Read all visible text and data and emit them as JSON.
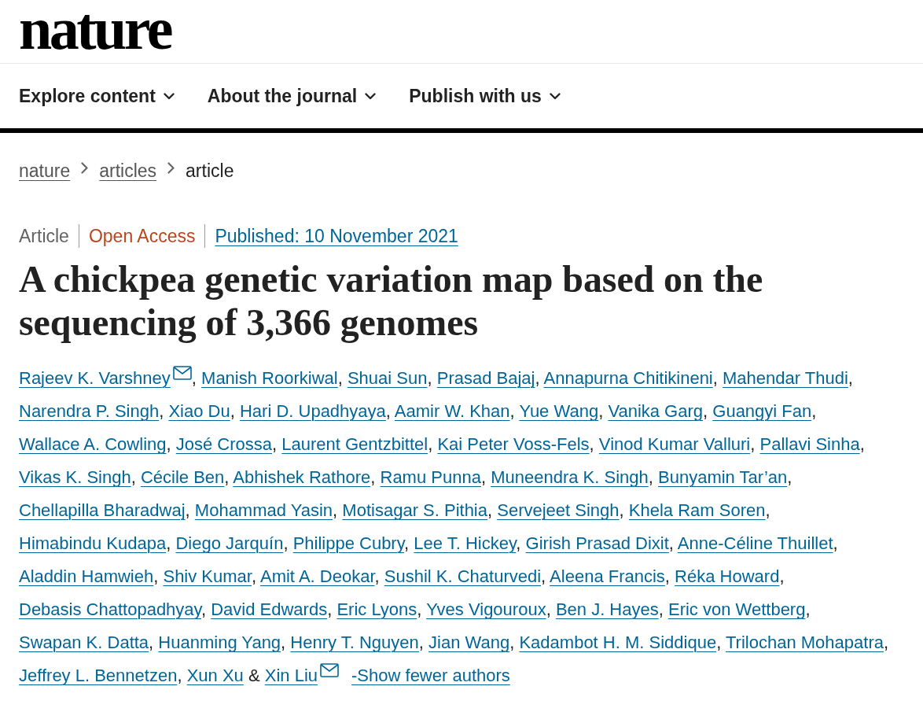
{
  "logo": "nature",
  "nav": [
    {
      "label": "Explore content"
    },
    {
      "label": "About the journal"
    },
    {
      "label": "Publish with us"
    }
  ],
  "breadcrumb": [
    {
      "label": "nature",
      "current": false
    },
    {
      "label": "articles",
      "current": false
    },
    {
      "label": "article",
      "current": true
    }
  ],
  "meta": {
    "article_type": "Article",
    "access": "Open Access",
    "published": "Published: 10 November 2021"
  },
  "title": "A chickpea genetic variation map based on the sequencing of 3,366 genomes",
  "authors": [
    {
      "name": "Rajeev K. Varshney",
      "email": true,
      "separator": ","
    },
    {
      "name": "Manish Roorkiwal",
      "email": false,
      "separator": ","
    },
    {
      "name": "Shuai Sun",
      "email": false,
      "separator": ","
    },
    {
      "name": "Prasad Bajaj",
      "email": false,
      "separator": ","
    },
    {
      "name": "Annapurna Chitikineni",
      "email": false,
      "separator": ","
    },
    {
      "name": "Mahendar Thudi",
      "email": false,
      "separator": ","
    },
    {
      "name": "Narendra P. Singh",
      "email": false,
      "separator": ","
    },
    {
      "name": "Xiao Du",
      "email": false,
      "separator": ","
    },
    {
      "name": "Hari D. Upadhyaya",
      "email": false,
      "separator": ","
    },
    {
      "name": "Aamir W. Khan",
      "email": false,
      "separator": ","
    },
    {
      "name": "Yue Wang",
      "email": false,
      "separator": ","
    },
    {
      "name": "Vanika Garg",
      "email": false,
      "separator": ","
    },
    {
      "name": "Guangyi Fan",
      "email": false,
      "separator": ","
    },
    {
      "name": "Wallace A. Cowling",
      "email": false,
      "separator": ","
    },
    {
      "name": "José Crossa",
      "email": false,
      "separator": ","
    },
    {
      "name": "Laurent Gentzbittel",
      "email": false,
      "separator": ","
    },
    {
      "name": "Kai Peter Voss-Fels",
      "email": false,
      "separator": ","
    },
    {
      "name": "Vinod Kumar Valluri",
      "email": false,
      "separator": ","
    },
    {
      "name": "Pallavi Sinha",
      "email": false,
      "separator": ","
    },
    {
      "name": "Vikas K. Singh",
      "email": false,
      "separator": ","
    },
    {
      "name": "Cécile Ben",
      "email": false,
      "separator": ","
    },
    {
      "name": "Abhishek Rathore",
      "email": false,
      "separator": ","
    },
    {
      "name": "Ramu Punna",
      "email": false,
      "separator": ","
    },
    {
      "name": "Muneendra K. Singh",
      "email": false,
      "separator": ","
    },
    {
      "name": "Bunyamin Tar’an",
      "email": false,
      "separator": ","
    },
    {
      "name": "Chellapilla Bharadwaj",
      "email": false,
      "separator": ","
    },
    {
      "name": "Mohammad Yasin",
      "email": false,
      "separator": ","
    },
    {
      "name": "Motisagar S. Pithia",
      "email": false,
      "separator": ","
    },
    {
      "name": "Servejeet Singh",
      "email": false,
      "separator": ","
    },
    {
      "name": "Khela Ram Soren",
      "email": false,
      "separator": ","
    },
    {
      "name": "Himabindu Kudapa",
      "email": false,
      "separator": ","
    },
    {
      "name": "Diego Jarquín",
      "email": false,
      "separator": ","
    },
    {
      "name": "Philippe Cubry",
      "email": false,
      "separator": ","
    },
    {
      "name": "Lee T. Hickey",
      "email": false,
      "separator": ","
    },
    {
      "name": "Girish Prasad Dixit",
      "email": false,
      "separator": ","
    },
    {
      "name": "Anne-Céline Thuillet",
      "email": false,
      "separator": ","
    },
    {
      "name": "Aladdin Hamwieh",
      "email": false,
      "separator": ","
    },
    {
      "name": "Shiv Kumar",
      "email": false,
      "separator": ","
    },
    {
      "name": "Amit A. Deokar",
      "email": false,
      "separator": ","
    },
    {
      "name": "Sushil K. Chaturvedi",
      "email": false,
      "separator": ","
    },
    {
      "name": "Aleena Francis",
      "email": false,
      "separator": ","
    },
    {
      "name": "Réka Howard",
      "email": false,
      "separator": ","
    },
    {
      "name": "Debasis Chattopadhyay",
      "email": false,
      "separator": ","
    },
    {
      "name": "David Edwards",
      "email": false,
      "separator": ","
    },
    {
      "name": "Eric Lyons",
      "email": false,
      "separator": ","
    },
    {
      "name": "Yves Vigouroux",
      "email": false,
      "separator": ","
    },
    {
      "name": "Ben J. Hayes",
      "email": false,
      "separator": ","
    },
    {
      "name": "Eric von Wettberg",
      "email": false,
      "separator": ","
    },
    {
      "name": "Swapan K. Datta",
      "email": false,
      "separator": ","
    },
    {
      "name": "Huanming Yang",
      "email": false,
      "separator": ","
    },
    {
      "name": "Henry T. Nguyen",
      "email": false,
      "separator": ","
    },
    {
      "name": "Jian Wang",
      "email": false,
      "separator": ","
    },
    {
      "name": "Kadambot H. M. Siddique",
      "email": false,
      "separator": ","
    },
    {
      "name": "Trilochan Mohapatra",
      "email": false,
      "separator": ","
    },
    {
      "name": "Jeffrey L. Bennetzen",
      "email": false,
      "separator": ","
    },
    {
      "name": "Xun Xu",
      "email": false,
      "conjunction": "&"
    },
    {
      "name": "Xin Liu",
      "email": true
    }
  ],
  "authors_toggle": "-Show fewer authors"
}
